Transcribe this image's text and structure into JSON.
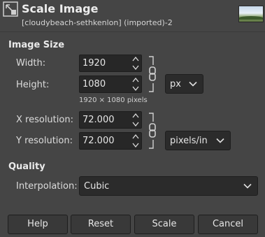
{
  "dialog": {
    "title": "Scale Image",
    "subtitle": "[cloudybeach-sethkenlon] (imported)-2"
  },
  "image_size": {
    "heading": "Image Size",
    "width_label": "Width:",
    "width_value": "1920",
    "height_label": "Height:",
    "height_value": "1080",
    "pixel_summary": "1920 × 1080 pixels",
    "unit": "px"
  },
  "resolution": {
    "x_label": "X resolution:",
    "x_value": "72.000",
    "y_label": "Y resolution:",
    "y_value": "72.000",
    "unit": "pixels/in"
  },
  "quality": {
    "heading": "Quality",
    "interpolation_label": "Interpolation:",
    "interpolation_value": "Cubic"
  },
  "buttons": {
    "help": "Help",
    "reset": "Reset",
    "scale": "Scale",
    "cancel": "Cancel"
  },
  "icons": {
    "title_icon": "scale-image-icon",
    "chain": "chain-link-icon",
    "caret": "chevron-down-icon",
    "spin_up": "arrow-up-icon",
    "spin_down": "arrow-down-icon"
  }
}
